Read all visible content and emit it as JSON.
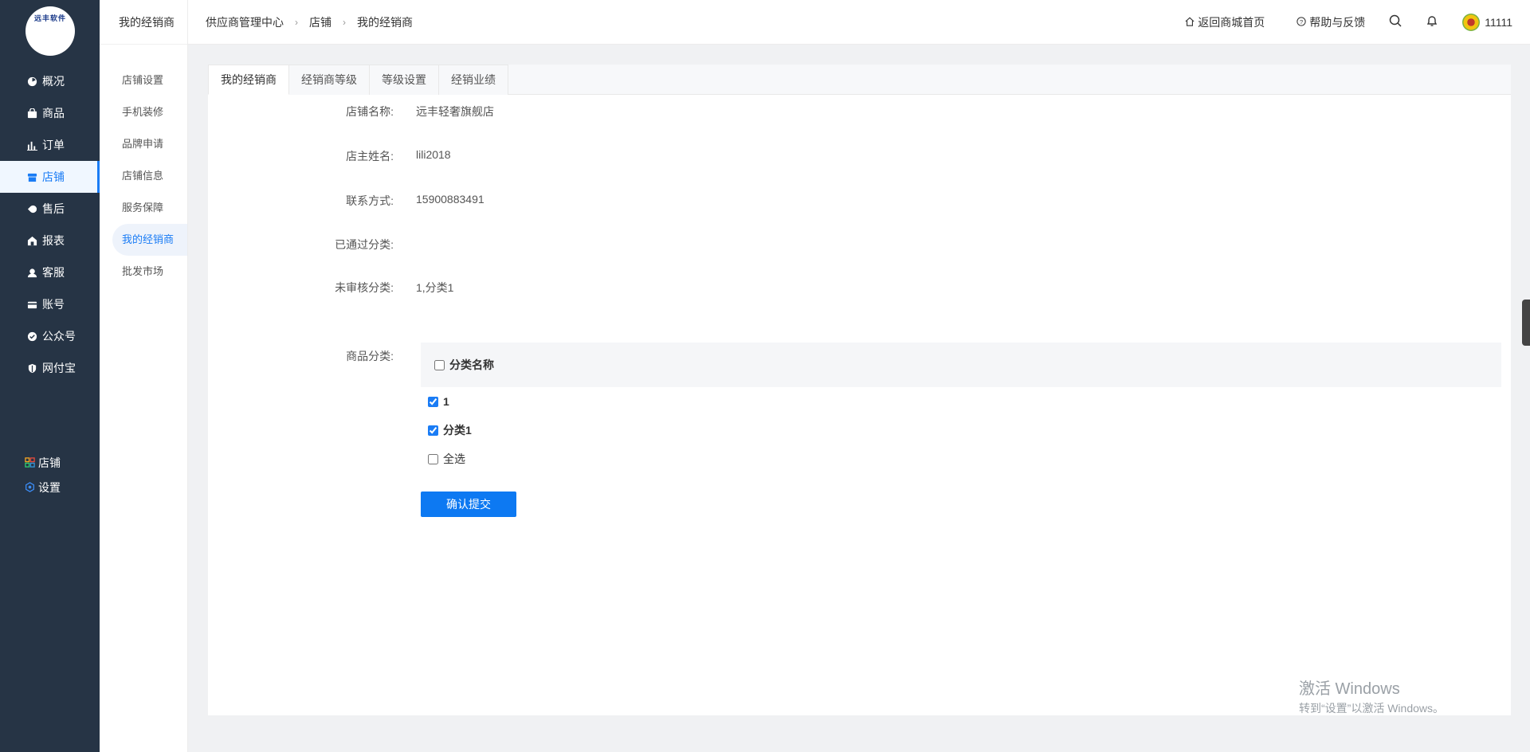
{
  "logo": {
    "text": "远丰软件"
  },
  "nav": {
    "items": [
      {
        "label": "概况",
        "icon": "dashboard-icon"
      },
      {
        "label": "商品",
        "icon": "bag-icon"
      },
      {
        "label": "订单",
        "icon": "bar-chart-icon"
      },
      {
        "label": "店铺",
        "icon": "store-icon",
        "active": true
      },
      {
        "label": "售后",
        "icon": "service-icon"
      },
      {
        "label": "报表",
        "icon": "report-icon"
      },
      {
        "label": "客服",
        "icon": "customer-service-icon"
      },
      {
        "label": "账号",
        "icon": "card-icon"
      },
      {
        "label": "公众号",
        "icon": "badge-check-icon"
      },
      {
        "label": "网付宝",
        "icon": "shield-icon"
      }
    ],
    "bottom": [
      {
        "label": "店铺",
        "icon": "grid-icon"
      },
      {
        "label": "设置",
        "icon": "settings-icon"
      }
    ]
  },
  "subnav": {
    "title": "我的经销商",
    "items": [
      {
        "label": "店铺设置"
      },
      {
        "label": "手机装修"
      },
      {
        "label": "品牌申请"
      },
      {
        "label": "店铺信息"
      },
      {
        "label": "服务保障"
      },
      {
        "label": "我的经销商",
        "active": true
      },
      {
        "label": "批发市场"
      }
    ]
  },
  "header": {
    "breadcrumb": [
      "供应商管理中心",
      "店铺",
      "我的经销商"
    ],
    "back_home": "返回商城首页",
    "help": "帮助与反馈",
    "username": "11111"
  },
  "tabs": [
    {
      "label": "我的经销商",
      "active": true
    },
    {
      "label": "经销商等级"
    },
    {
      "label": "等级设置"
    },
    {
      "label": "经销业绩"
    }
  ],
  "form": {
    "store_name_label": "店铺名称:",
    "store_name": "远丰轻奢旗舰店",
    "owner_label": "店主姓名:",
    "owner": "lili2018",
    "contact_label": "联系方式:",
    "contact": "15900883491",
    "approved_label": "已通过分类:",
    "approved": "",
    "pending_label": "未审核分类:",
    "pending": "1,分类1",
    "category_label": "商品分类:"
  },
  "categories": {
    "header": "分类名称",
    "rows": [
      {
        "label": "1",
        "checked": true
      },
      {
        "label": "分类1",
        "checked": true
      }
    ],
    "select_all": "全选"
  },
  "submit_label": "确认提交",
  "watermark": {
    "title": "激活 Windows",
    "subtitle": "转到“设置”以激活 Windows。"
  },
  "colors": {
    "accent": "#0d79f2",
    "sidebar_bg": "#263445"
  }
}
